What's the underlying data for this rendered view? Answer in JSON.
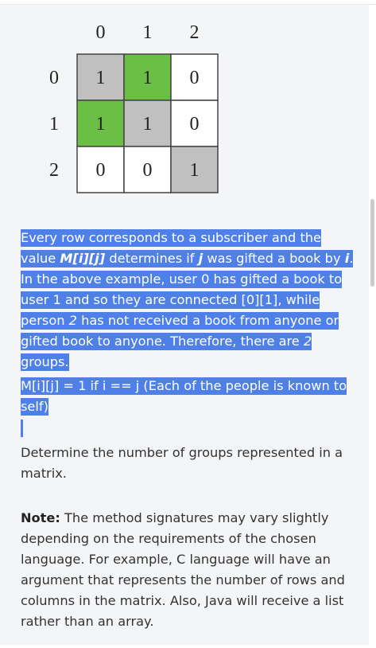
{
  "matrix": {
    "col_headers": [
      "0",
      "1",
      "2"
    ],
    "row_headers": [
      "0",
      "1",
      "2"
    ],
    "cells": [
      [
        {
          "v": "1",
          "fill": "#c0c0c0"
        },
        {
          "v": "1",
          "fill": "#6cbf45"
        },
        {
          "v": "0",
          "fill": "#ffffff"
        }
      ],
      [
        {
          "v": "1",
          "fill": "#6cbf45"
        },
        {
          "v": "1",
          "fill": "#c0c0c0"
        },
        {
          "v": "0",
          "fill": "#ffffff"
        }
      ],
      [
        {
          "v": "0",
          "fill": "#ffffff"
        },
        {
          "v": "0",
          "fill": "#ffffff"
        },
        {
          "v": "1",
          "fill": "#c0c0c0"
        }
      ]
    ],
    "grid_color": "#444444"
  },
  "selection_color": "#4f80e8",
  "para1": {
    "t1": "Every row corresponds to a subscriber and the value ",
    "mij": "M[i][j]",
    "t2": " determines if ",
    "j": "j",
    "t3": " was gifted a book by ",
    "i": "i",
    "t4": ". In the above example, user 0 has gifted a book to user 1 and so they are connected [0][1], while person ",
    "two_a": "2",
    "t5": " has not received a book from anyone or gifted book to anyone. Therefore, there are ",
    "two_b": "2",
    "t6": " groups."
  },
  "para2": "M[i][j] = 1 if i == j (Each of the people is known to self)",
  "para3": "Determine the number of groups represented in a matrix.",
  "note": {
    "label": "Note:",
    "text": " The method signatures may vary slightly depending on the requirements of the chosen language. For example, C language will have an argument that represents the number of rows and columns in the matrix. Also, Java will receive a list rather than an array."
  }
}
